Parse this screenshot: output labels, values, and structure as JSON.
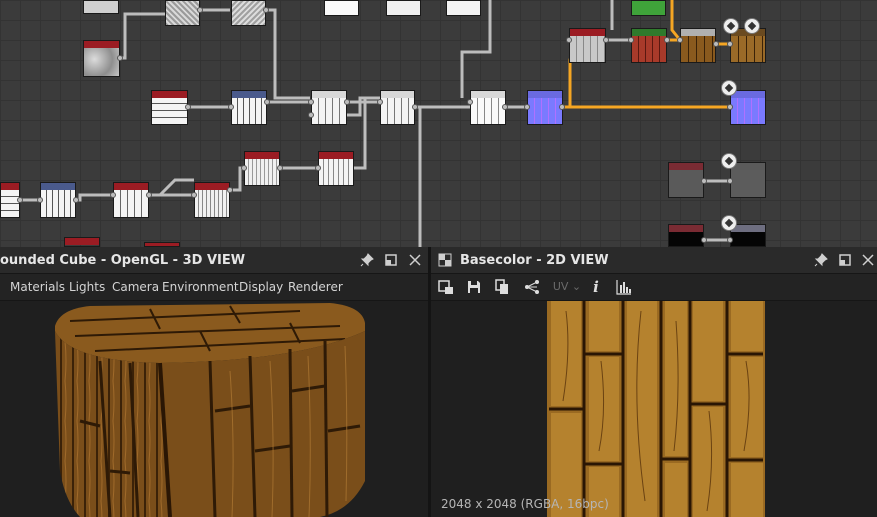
{
  "panel3d": {
    "title": "ounded Cube - OpenGL - 3D VIEW",
    "menus": [
      "Materials",
      "Lights",
      "Camera",
      "Environment",
      "Display",
      "Renderer"
    ],
    "icons": [
      "pin-icon",
      "restore-window-icon",
      "close-icon"
    ]
  },
  "panel2d": {
    "title": "Basecolor - 2D VIEW",
    "tools": [
      "export-icon",
      "save-icon",
      "copy-icon",
      "share-graph-icon",
      "uv-dropdown",
      "info-icon",
      "histogram-icon"
    ],
    "uv_label": "UV",
    "info_label": "i",
    "resolution": "2048 x 2048 (RGBA, 16bpc)",
    "icons": [
      "pin-icon",
      "restore-window-icon",
      "close-icon"
    ]
  },
  "colors": {
    "graph_bg": "#3b3b3b",
    "selected_link": "#f5a623",
    "link": "#bdbdbd",
    "node_header_red": "#9b1c23",
    "node_header_blue": "#4a5a8c",
    "wood": "#8a5a1e"
  }
}
